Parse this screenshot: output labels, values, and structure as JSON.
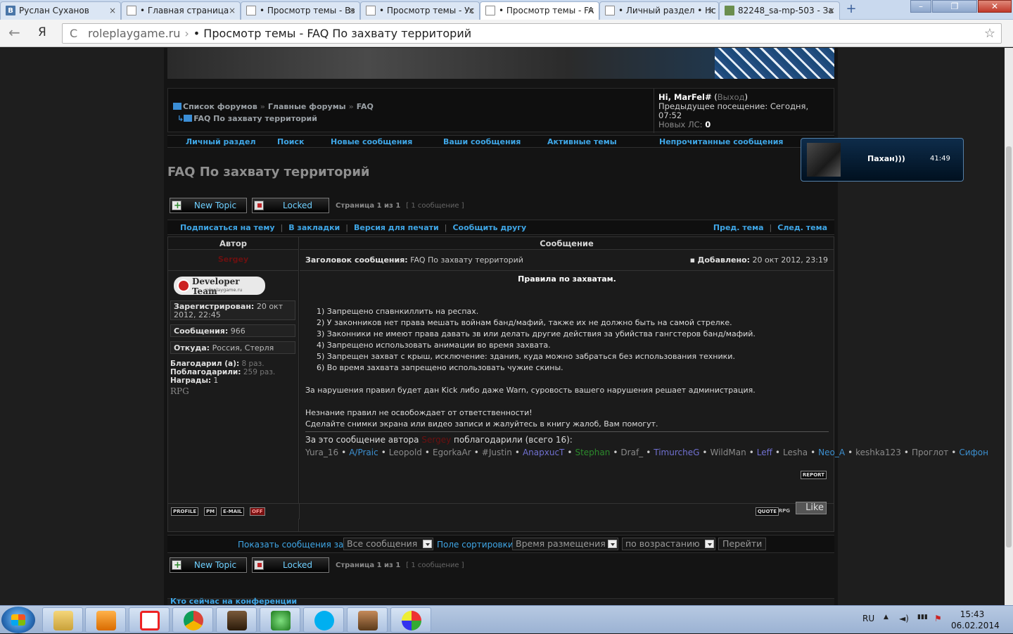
{
  "browser": {
    "tabs": [
      {
        "title": "Руслан Суханов",
        "icon": "vk-icon"
      },
      {
        "title": "• Главная страница",
        "icon": "page-icon"
      },
      {
        "title": "• Просмотр темы - Вз",
        "icon": "page-icon"
      },
      {
        "title": "• Просмотр темы - Ус",
        "icon": "page-icon"
      },
      {
        "title": "• Просмотр темы - FA",
        "icon": "page-icon"
      },
      {
        "title": "• Личный раздел • Нс",
        "icon": "page-icon"
      },
      {
        "title": "82248_sa-mp-503 - За",
        "icon": "image-icon"
      }
    ],
    "back_glyph": "←",
    "ya_glyph": "Я",
    "reload_glyph": "C",
    "star_glyph": "☆",
    "newtab_glyph": "+",
    "tab_close_glyph": "×",
    "win_min": "–",
    "win_max": "❐",
    "win_close": "✕",
    "url_domain": "roleplaygame.ru",
    "url_sep": "›",
    "url_title": "• Просмотр темы - FAQ По захвату территорий"
  },
  "header": {
    "crumbs": [
      "Список форумов",
      "Главные форумы",
      "FAQ"
    ],
    "crumb_sep": "»",
    "current": "FAQ По захвату территорий",
    "user": {
      "greeting": "Hi, MarFel#",
      "logout_open": "(",
      "logout": "Выход",
      "logout_close": ")",
      "last_visit_label": "Предыдущее посещение: Сегодня, 07:52",
      "new_pm_label": "Новых ЛС:",
      "new_pm_count": "0"
    }
  },
  "nav": [
    "Личный раздел",
    "Поиск",
    "Новые сообщения",
    "Ваши сообщения",
    "Активные темы",
    "Непрочитанные сообщения"
  ],
  "topic": {
    "title": "FAQ По захвату территорий",
    "btn_new": "New Topic",
    "btn_locked": "Locked",
    "page_info": "Страница 1 из 1",
    "post_count": "[ 1 сообщение ]"
  },
  "actions": {
    "left": [
      "Подписаться на тему",
      "В закладки",
      "Версия для печати",
      "Сообщить другу"
    ],
    "right": [
      "Пред. тема",
      "След. тема"
    ],
    "pipe": "|"
  },
  "table": {
    "col_author": "Автор",
    "col_post": "Сообщение"
  },
  "author": {
    "name": "Sergey",
    "rank_title": "Developer Team",
    "rank_site": "roleplaygame.ru",
    "registered_label": "Зарегистрирован:",
    "registered_value": "20 окт 2012, 22:45",
    "posts_label": "Сообщения:",
    "posts_value": "966",
    "from_label": "Откуда:",
    "from_value": "Россия, Стерля",
    "thanked_label": "Благодарил (а):",
    "thanked_value": "8 раз.",
    "was_thanked_label": "Поблагодарили:",
    "was_thanked_value": "259 раз.",
    "awards_label": "Награды:",
    "awards_value": "1",
    "rpg": "RPG"
  },
  "post": {
    "subject_label": "Заголовок сообщения:",
    "subject": "FAQ По захвату территорий",
    "added_label": "Добавлено:",
    "added": "20 окт 2012, 23:19",
    "body_title": "Правила по захватам.",
    "rules": [
      "1) Запрещено спавнкиллить на респах.",
      "2) У законников нет права мешать войнам банд/мафий, также их не должно быть на самой стрелке.",
      "3) Законники не имеют права давать зв или делать другие действия за убийства гангстеров банд/мафий.",
      "4) Запрещено использовать анимации во время захвата.",
      "5) Запрещен захват с крыш, исключение: здания, куда можно забраться без использования техники.",
      "6) Во время захвата запрещено использовать чужие скины."
    ],
    "para1": "За нарушения правил будет дан Kick либо даже Warn, суровость вашего нарушения решает администрация.",
    "para2a": "Незнание правил не освобождает от ответственности!",
    "para2b": "Сделайте снимки экрана или видео записи и жалуйтесь в книгу жалоб, Вам помогут.",
    "thanks_prefix": "За это сообщение автора",
    "thanks_author": "Sergey",
    "thanks_suffix": "поблагодарили (всего 16):",
    "thanks_names": [
      {
        "n": "Yura_16",
        "c": "g"
      },
      {
        "n": "A/Praic",
        "c": "b"
      },
      {
        "n": "Leopold",
        "c": "g"
      },
      {
        "n": "EgorkaAr",
        "c": "g"
      },
      {
        "n": "#Justin",
        "c": "g"
      },
      {
        "n": "AnapxucT",
        "c": "p"
      },
      {
        "n": "Stephan",
        "c": "gr"
      },
      {
        "n": "Draf_",
        "c": "g"
      },
      {
        "n": "TimurcheG",
        "c": "p"
      },
      {
        "n": "WildMan",
        "c": "g"
      },
      {
        "n": "Leff",
        "c": "p"
      },
      {
        "n": "Lesha",
        "c": "g"
      },
      {
        "n": "Neo_A",
        "c": "b"
      },
      {
        "n": "keshka123",
        "c": "g"
      },
      {
        "n": "Проглот",
        "c": "g"
      },
      {
        "n": "Сифон",
        "c": "b"
      }
    ],
    "name_sep": "•",
    "report": "REPORT",
    "profile": "PROFILE",
    "pm": "PM",
    "email": "E-MAIL",
    "off": "OFF",
    "quote": "QUOTE",
    "rpg_btn": "RPG",
    "like": "Like"
  },
  "sort": {
    "show_label": "Показать сообщения за:",
    "show_value": "Все сообщения",
    "sort_label": "Поле сортировки",
    "sort_value": "Время размещения",
    "dir_value": "по возрастанию",
    "go": "Перейти"
  },
  "online": "Кто сейчас на конференции",
  "notification": {
    "name": "Пахан)))",
    "time": "41:49"
  },
  "taskbar": {
    "lang": "RU",
    "time": "15:43",
    "date": "06.02.2014",
    "up": "▲",
    "vol": "◄)",
    "net": "▮▮▮",
    "flag": "⚑"
  }
}
